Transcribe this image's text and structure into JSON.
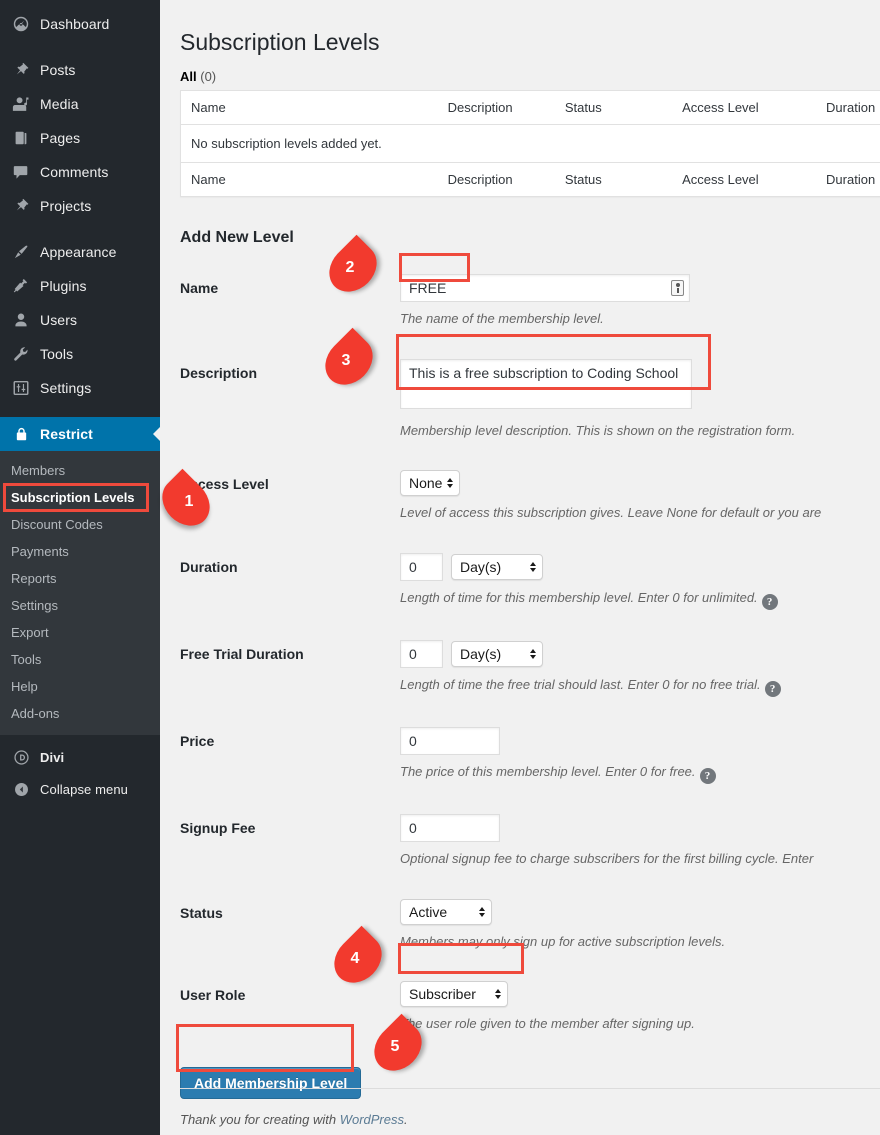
{
  "sidebar": {
    "top_items": [
      {
        "label": "Dashboard",
        "icon": "dashboard-icon"
      },
      {
        "label": "Posts",
        "icon": "pin-icon"
      },
      {
        "label": "Media",
        "icon": "media-icon"
      },
      {
        "label": "Pages",
        "icon": "pages-icon"
      },
      {
        "label": "Comments",
        "icon": "comment-icon"
      },
      {
        "label": "Projects",
        "icon": "pin-icon"
      }
    ],
    "mid_items": [
      {
        "label": "Appearance",
        "icon": "paintbrush-icon"
      },
      {
        "label": "Plugins",
        "icon": "plug-icon"
      },
      {
        "label": "Users",
        "icon": "user-icon"
      },
      {
        "label": "Tools",
        "icon": "wrench-icon"
      },
      {
        "label": "Settings",
        "icon": "sliders-icon"
      }
    ],
    "active_item": {
      "label": "Restrict",
      "icon": "lock-icon"
    },
    "submenu": [
      {
        "label": "Members",
        "current": false
      },
      {
        "label": "Subscription Levels",
        "current": true
      },
      {
        "label": "Discount Codes",
        "current": false
      },
      {
        "label": "Payments",
        "current": false
      },
      {
        "label": "Reports",
        "current": false
      },
      {
        "label": "Settings",
        "current": false
      },
      {
        "label": "Export",
        "current": false
      },
      {
        "label": "Tools",
        "current": false
      },
      {
        "label": "Help",
        "current": false
      },
      {
        "label": "Add-ons",
        "current": false
      }
    ],
    "bottom_items": [
      {
        "label": "Divi",
        "icon": "divi-icon"
      },
      {
        "label": "Collapse menu",
        "icon": "collapse-icon"
      }
    ]
  },
  "page": {
    "title": "Subscription Levels",
    "filter_label": "All",
    "filter_count": "(0)",
    "table": {
      "headers": [
        "Name",
        "Description",
        "Status",
        "Access Level",
        "Duration"
      ],
      "empty_message": "No subscription levels added yet."
    },
    "form_heading": "Add New Level",
    "fields": {
      "name": {
        "label": "Name",
        "value": "FREE",
        "description": "The name of the membership level."
      },
      "description": {
        "label": "Description",
        "value": "This is a free subscription to Coding School",
        "description": "Membership level description. This is shown on the registration form."
      },
      "access_level": {
        "label": "Access Level",
        "value": "None",
        "description": "Level of access this subscription gives. Leave None for default or you are"
      },
      "duration": {
        "label": "Duration",
        "value": "0",
        "unit": "Day(s)",
        "description": "Length of time for this membership level. Enter 0 for unlimited."
      },
      "free_trial_duration": {
        "label": "Free Trial Duration",
        "value": "0",
        "unit": "Day(s)",
        "description": "Length of time the free trial should last. Enter 0 for no free trial."
      },
      "price": {
        "label": "Price",
        "value": "0",
        "description": "The price of this membership level. Enter 0 for free."
      },
      "signup_fee": {
        "label": "Signup Fee",
        "value": "0",
        "description": "Optional signup fee to charge subscribers for the first billing cycle. Enter"
      },
      "status": {
        "label": "Status",
        "value": "Active",
        "description": "Members may only sign up for active subscription levels."
      },
      "user_role": {
        "label": "User Role",
        "value": "Subscriber",
        "description": "The user role given to the member after signing up."
      }
    },
    "submit_label": "Add Membership Level",
    "footer_text": "Thank you for creating with ",
    "footer_link": "WordPress",
    "footer_period": "."
  },
  "annotations": {
    "markers": [
      {
        "number": "1"
      },
      {
        "number": "2"
      },
      {
        "number": "3"
      },
      {
        "number": "4"
      },
      {
        "number": "5"
      }
    ]
  },
  "colors": {
    "accent_blue": "#0073aa",
    "annotation_red": "#f23a2e",
    "button_blue": "#2b7cb0",
    "sidebar_bg": "#23282d",
    "submenu_bg": "#32373c"
  }
}
